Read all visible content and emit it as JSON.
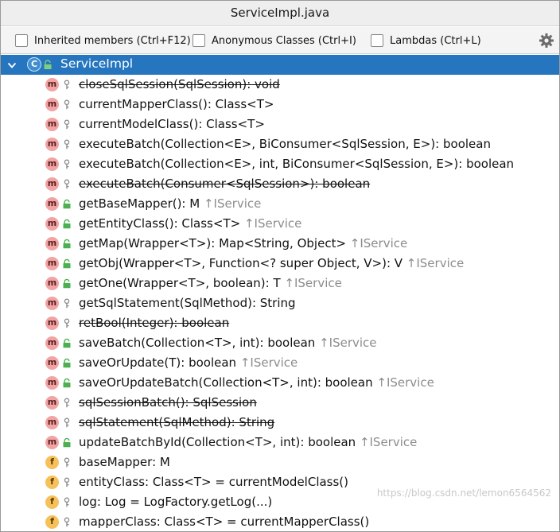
{
  "window": {
    "title": "ServiceImpl.java"
  },
  "options": [
    {
      "label": "Inherited members (Ctrl+F12)",
      "checked": false
    },
    {
      "label": "Anonymous Classes (Ctrl+I)",
      "checked": false
    },
    {
      "label": "Lambdas (Ctrl+L)",
      "checked": false
    }
  ],
  "settings_icon": "gear-icon",
  "root": {
    "label": "ServiceImpl",
    "icon": "class-icon",
    "icon_letter": "C",
    "expanded": true
  },
  "members": [
    {
      "kind": "m",
      "vis": "protected",
      "text": "closeSqlSession(SqlSession): void",
      "deprecated": true,
      "inherited": ""
    },
    {
      "kind": "m",
      "vis": "protected",
      "text": "currentMapperClass(): Class<T>",
      "deprecated": false,
      "inherited": ""
    },
    {
      "kind": "m",
      "vis": "protected",
      "text": "currentModelClass(): Class<T>",
      "deprecated": false,
      "inherited": ""
    },
    {
      "kind": "m",
      "vis": "protected",
      "text": "executeBatch(Collection<E>, BiConsumer<SqlSession, E>): boolean",
      "deprecated": false,
      "inherited": ""
    },
    {
      "kind": "m",
      "vis": "protected",
      "text": "executeBatch(Collection<E>, int, BiConsumer<SqlSession, E>): boolean",
      "deprecated": false,
      "inherited": ""
    },
    {
      "kind": "m",
      "vis": "protected",
      "text": "executeBatch(Consumer<SqlSession>): boolean",
      "deprecated": true,
      "inherited": ""
    },
    {
      "kind": "m",
      "vis": "public",
      "text": "getBaseMapper(): M ",
      "deprecated": false,
      "inherited": "↑IService"
    },
    {
      "kind": "m",
      "vis": "public",
      "text": "getEntityClass(): Class<T> ",
      "deprecated": false,
      "inherited": "↑IService"
    },
    {
      "kind": "m",
      "vis": "public",
      "text": "getMap(Wrapper<T>): Map<String, Object> ",
      "deprecated": false,
      "inherited": "↑IService"
    },
    {
      "kind": "m",
      "vis": "public",
      "text": "getObj(Wrapper<T>, Function<? super Object, V>): V ",
      "deprecated": false,
      "inherited": "↑IService"
    },
    {
      "kind": "m",
      "vis": "public",
      "text": "getOne(Wrapper<T>, boolean): T ",
      "deprecated": false,
      "inherited": "↑IService"
    },
    {
      "kind": "m",
      "vis": "protected",
      "text": "getSqlStatement(SqlMethod): String",
      "deprecated": false,
      "inherited": ""
    },
    {
      "kind": "m",
      "vis": "protected",
      "text": "retBool(Integer): boolean",
      "deprecated": true,
      "inherited": ""
    },
    {
      "kind": "m",
      "vis": "public",
      "text": "saveBatch(Collection<T>, int): boolean ",
      "deprecated": false,
      "inherited": "↑IService"
    },
    {
      "kind": "m",
      "vis": "public",
      "text": "saveOrUpdate(T): boolean ",
      "deprecated": false,
      "inherited": "↑IService"
    },
    {
      "kind": "m",
      "vis": "public",
      "text": "saveOrUpdateBatch(Collection<T>, int): boolean ",
      "deprecated": false,
      "inherited": "↑IService"
    },
    {
      "kind": "m",
      "vis": "protected",
      "text": "sqlSessionBatch(): SqlSession",
      "deprecated": true,
      "inherited": ""
    },
    {
      "kind": "m",
      "vis": "protected",
      "text": "sqlStatement(SqlMethod): String",
      "deprecated": true,
      "inherited": ""
    },
    {
      "kind": "m",
      "vis": "public",
      "text": "updateBatchById(Collection<T>, int): boolean ",
      "deprecated": false,
      "inherited": "↑IService"
    },
    {
      "kind": "f",
      "vis": "protected",
      "text": "baseMapper: M",
      "deprecated": false,
      "inherited": ""
    },
    {
      "kind": "f",
      "vis": "protected",
      "text": "entityClass: Class<T> = currentModelClass()",
      "deprecated": false,
      "inherited": ""
    },
    {
      "kind": "f",
      "vis": "protected",
      "text": "log: Log = LogFactory.getLog(...)",
      "deprecated": false,
      "inherited": ""
    },
    {
      "kind": "f",
      "vis": "protected",
      "text": "mapperClass: Class<T> = currentMapperClass()",
      "deprecated": false,
      "inherited": ""
    }
  ],
  "watermark": "https://blog.csdn.net/lemon6564562",
  "colors": {
    "selection": "#2675bf",
    "method_icon": "#f2a4a4",
    "field_icon": "#f6c05a",
    "public_lock": "#4caf50",
    "inherited_text": "#8c8c8c"
  }
}
